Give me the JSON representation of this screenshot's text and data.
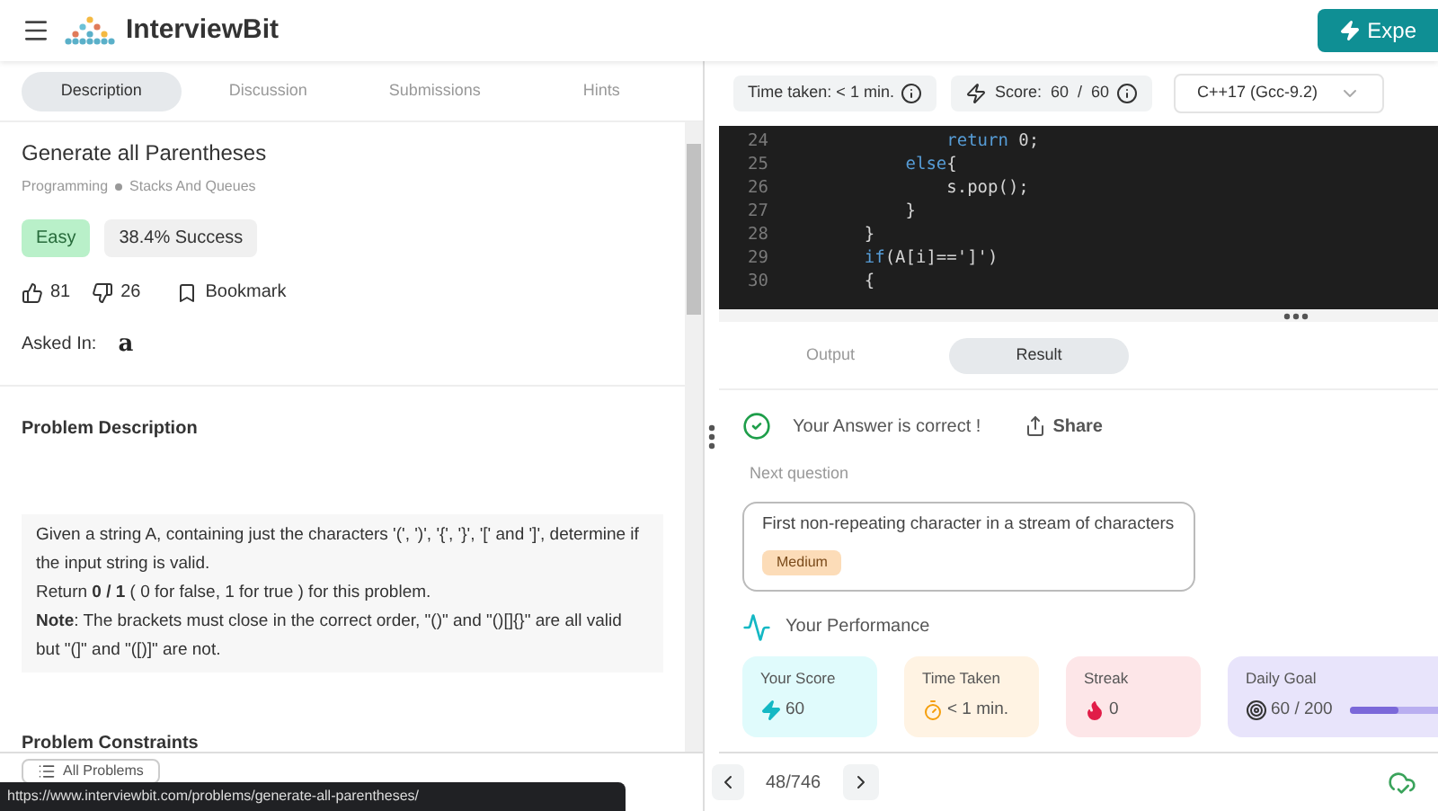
{
  "header": {
    "logo": "InterviewBit",
    "cta": "Expe"
  },
  "tabs": [
    {
      "label": "Description",
      "selected": true
    },
    {
      "label": "Discussion",
      "selected": false
    },
    {
      "label": "Submissions",
      "selected": false
    },
    {
      "label": "Hints",
      "selected": false
    }
  ],
  "problem": {
    "title": "Generate all Parentheses",
    "breadcrumb": [
      "Programming",
      "Stacks And Queues"
    ],
    "difficulty": "Easy",
    "success": "38.4% Success",
    "likes": "81",
    "dislikes": "26",
    "bookmark": "Bookmark",
    "asked_in": "Asked In:",
    "company": "a"
  },
  "description": {
    "heading": "Problem Description",
    "lines": [
      "Given a string A, containing just the characters '(', ')', '{', '}', '[' and ']', determine if the input string is valid.",
      "Return **0 / 1** ( 0 for false, 1 for true ) for this problem.",
      "**Note**:  The brackets must close in the correct order, \"()\" and \"()[]{}\" are all valid but \"(]\" and \"([)]\" are not."
    ]
  },
  "constraints": {
    "heading": "Problem Constraints"
  },
  "left_footer": {
    "all_problems": "All Problems",
    "status_url": "https://www.interviewbit.com/problems/generate-all-parentheses/"
  },
  "toolbar": {
    "time": "Time taken: < 1 min.",
    "score": "Score:  60  /  60",
    "language": "C++17 (Gcc-9.2)"
  },
  "code": [
    {
      "number": "24",
      "segments": [
        {
          "kind": "keyword",
          "text": "            return"
        },
        {
          "kind": "plain",
          "text": " 0;"
        }
      ]
    },
    {
      "number": "25",
      "segments": [
        {
          "kind": "keyword",
          "text": "        else"
        },
        {
          "kind": "plain",
          "text": "{"
        }
      ]
    },
    {
      "number": "26",
      "segments": [
        {
          "kind": "plain",
          "text": "            s.pop();"
        }
      ]
    },
    {
      "number": "27",
      "segments": [
        {
          "kind": "plain",
          "text": "        }"
        }
      ]
    },
    {
      "number": "28",
      "segments": [
        {
          "kind": "plain",
          "text": "    }"
        }
      ]
    },
    {
      "number": "29",
      "segments": [
        {
          "kind": "keyword",
          "text": "    if"
        },
        {
          "kind": "plain",
          "text": "(A[i]==']')"
        }
      ]
    },
    {
      "number": "30",
      "segments": [
        {
          "kind": "plain",
          "text": "    {"
        }
      ]
    }
  ],
  "result_tabs": [
    {
      "label": "Output",
      "selected": false
    },
    {
      "label": "Result",
      "selected": true
    }
  ],
  "result": {
    "message": "Your Answer is correct !",
    "share": "Share",
    "next_label": "Next question",
    "next_title": "First non-repeating character in a stream of characters",
    "next_difficulty": "Medium",
    "performance": "Your Performance",
    "cards": [
      {
        "kind": "score",
        "label": "Your Score",
        "value": "60"
      },
      {
        "kind": "time",
        "label": "Time Taken",
        "value": "< 1 min."
      },
      {
        "kind": "streak",
        "label": "Streak",
        "value": "0"
      },
      {
        "kind": "goal",
        "label": "Daily Goal",
        "value": "60 / 200",
        "level": 0.3
      }
    ]
  },
  "pager": {
    "position": "48/746"
  }
}
